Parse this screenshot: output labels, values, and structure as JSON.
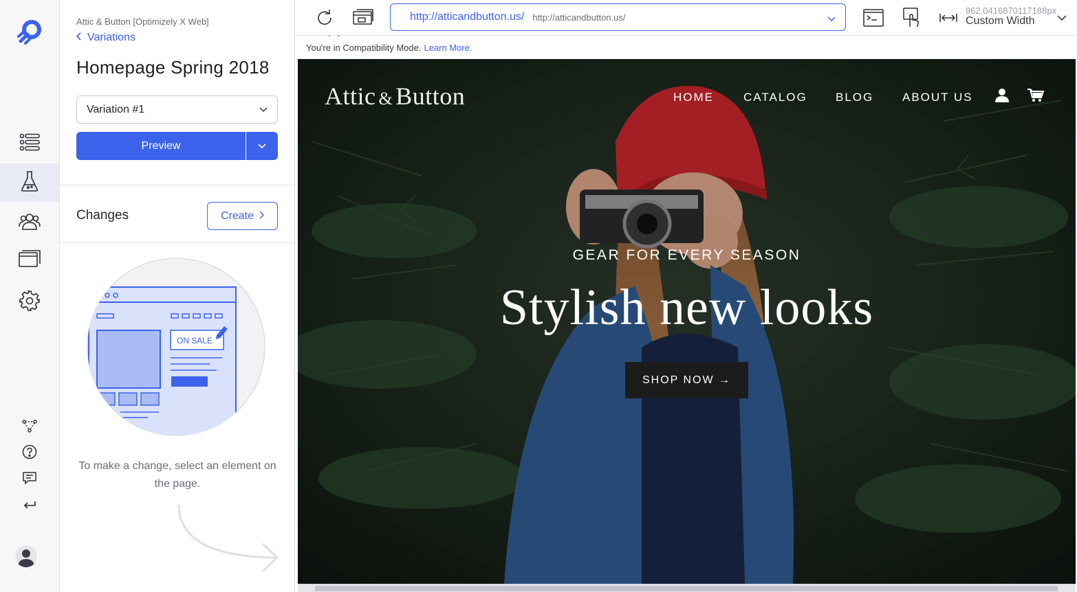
{
  "colors": {
    "accent": "#3c63ec",
    "rail_bg": "#f7f7f9",
    "hero_dark": "#142016",
    "hat_red": "#c8262b",
    "denim": "#2f5b8f"
  },
  "rail": {
    "logo_icon": "optimizely-logo-icon",
    "nav": [
      {
        "name": "experiments-list-icon",
        "active": false
      },
      {
        "name": "flask-icon",
        "active": true
      },
      {
        "name": "audiences-icon",
        "active": false
      },
      {
        "name": "pages-icon",
        "active": false
      },
      {
        "name": "gear-icon",
        "active": false
      }
    ],
    "bottom": [
      "network-icon",
      "help-icon",
      "feedback-icon",
      "back-arrow-icon"
    ],
    "avatar_icon": "user-avatar-icon"
  },
  "panel": {
    "project": "Attic & Button [Optimizely X Web]",
    "back_label": "Variations",
    "title": "Homepage Spring 2018",
    "variation": "Variation #1",
    "preview_label": "Preview",
    "changes_label": "Changes",
    "create_label": "Create",
    "illustration_text": "ON SALE",
    "hint": "To make a change, select an element on the page."
  },
  "toolbar": {
    "url_primary": "http://atticandbutton.us/",
    "url_secondary": "http://atticandbutton.us/",
    "width_value": "962.0416870117188px",
    "width_label": "Custom Width"
  },
  "compat": {
    "text": "You're in Compatibility Mode.",
    "link": "Learn More."
  },
  "site": {
    "brand_left": "Attic",
    "brand_amp": "&",
    "brand_right": "Button",
    "nav": [
      "HOME",
      "CATALOG",
      "BLOG",
      "ABOUT US"
    ],
    "kicker": "GEAR FOR EVERY SEASON",
    "headline": "Stylish new looks",
    "cta": "SHOP NOW →"
  }
}
